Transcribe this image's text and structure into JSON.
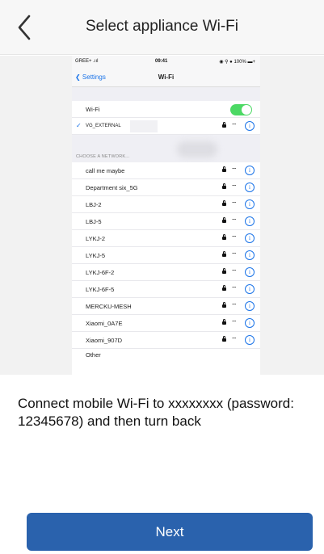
{
  "header": {
    "title": "Select appliance Wi-Fi"
  },
  "guide_phone": {
    "status": {
      "carrier": "GREE+ .ııl",
      "time": "09:41",
      "battery": "◉ ⚲ ● 100% ▬+"
    },
    "nav": {
      "back_label": "❮ Settings",
      "title": "Wi-Fi"
    },
    "wifi_toggle": {
      "label": "Wi-Fi",
      "on": true
    },
    "connected": {
      "name": "VG_EXTERNAL"
    },
    "section_header": "CHOOSE A NETWORK...",
    "networks": [
      {
        "name": "call me maybe"
      },
      {
        "name": "Department six_5G"
      },
      {
        "name": "LBJ-2"
      },
      {
        "name": "LBJ-5"
      },
      {
        "name": "LYKJ-2"
      },
      {
        "name": "LYKJ-5"
      },
      {
        "name": "LYKJ-6F-2"
      },
      {
        "name": "LYKJ-6F-5"
      },
      {
        "name": "MERCKU-MESH"
      },
      {
        "name": "Xiaomi_0A7E"
      },
      {
        "name": "Xiaomi_907D"
      }
    ],
    "other": "Other"
  },
  "message": "Connect mobile Wi-Fi to xxxxxxxx (password: 12345678) and then turn back",
  "next_label": "Next",
  "colors": {
    "accent": "#2a62ad",
    "toggle_on": "#4cd964",
    "ios_blue": "#1a73e8"
  }
}
